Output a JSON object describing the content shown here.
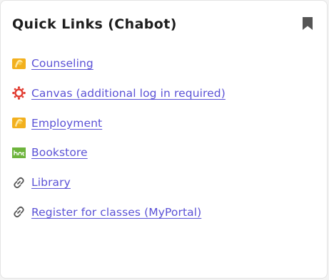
{
  "card": {
    "title": "Quick Links (Chabot)",
    "bookmark_icon": "bookmark-icon"
  },
  "links": [
    {
      "label": "Counseling",
      "icon": "chabot-logo-icon"
    },
    {
      "label": "Canvas (additional log in required)",
      "icon": "canvas-logo-icon"
    },
    {
      "label": "Employment",
      "icon": "chabot-logo-icon"
    },
    {
      "label": "Bookstore",
      "icon": "bookstore-logo-icon"
    },
    {
      "label": "Library",
      "icon": "link-icon"
    },
    {
      "label": "Register for classes (MyPortal)",
      "icon": "link-icon"
    }
  ],
  "colors": {
    "link": "#5b52d6",
    "title": "#1d1d1d",
    "canvas_red": "#e13a2f",
    "chabot_gold": "#f2b01e",
    "bookstore_green": "#6db43c"
  }
}
